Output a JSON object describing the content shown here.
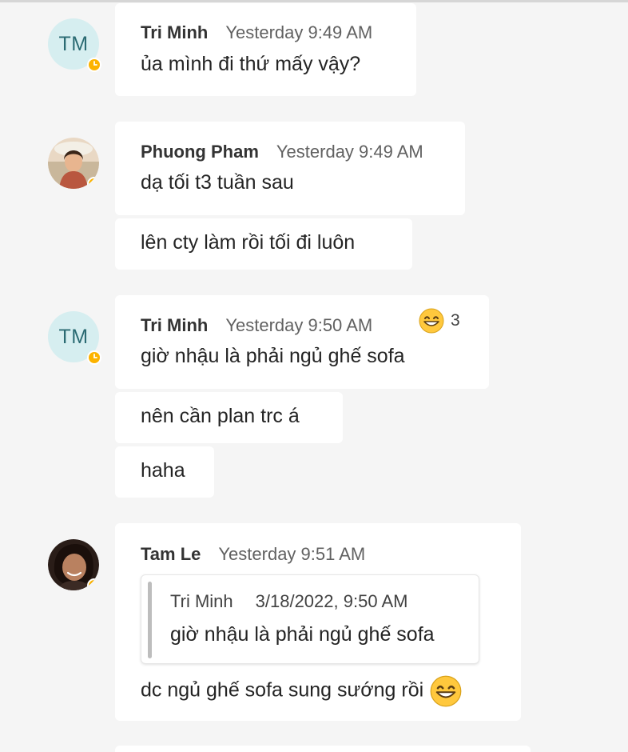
{
  "colors": {
    "background": "#f5f5f5",
    "bubble": "#ffffff",
    "status_away": "#fcb300",
    "initials_bg": "#d6eef0",
    "initials_text": "#2b6b73"
  },
  "messages": [
    {
      "author": "Tri Minh",
      "avatar_initials": "TM",
      "time": "Yesterday 9:49 AM",
      "lines": [
        "ủa mình đi thứ mấy vậy?"
      ]
    },
    {
      "author": "Phuong Pham",
      "avatar": "photo",
      "time": "Yesterday 9:49 AM",
      "lines": [
        "dạ tối t3 tuần sau",
        "lên cty làm rồi tối đi luôn"
      ]
    },
    {
      "author": "Tri Minh",
      "avatar_initials": "TM",
      "time": "Yesterday 9:50 AM",
      "reaction": {
        "icon": "grinning-face-emoji",
        "count": "3"
      },
      "lines": [
        "giờ nhậu là phải ngủ ghế sofa",
        "nên cần plan trc á",
        "haha"
      ]
    },
    {
      "author": "Tam Le",
      "avatar": "photo",
      "time": "Yesterday 9:51 AM",
      "quote": {
        "author": "Tri Minh",
        "time": "3/18/2022, 9:50 AM",
        "text": "giờ nhậu là phải ngủ ghế sofa"
      },
      "text": "dc ngủ ghế sofa sung sướng rồi",
      "text_emoji": "grinning-face-emoji"
    }
  ]
}
